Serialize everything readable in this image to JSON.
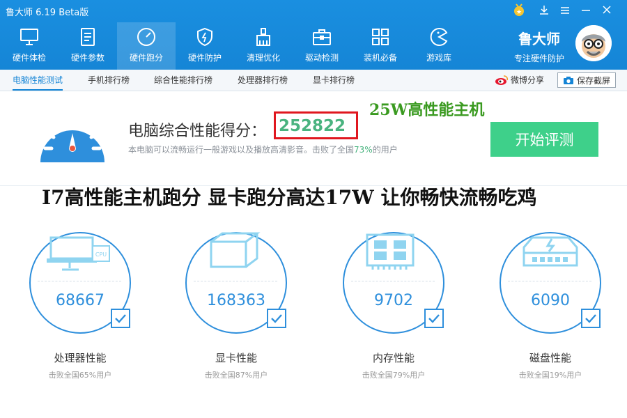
{
  "window": {
    "title": "鲁大师 6.19 Beta版"
  },
  "nav": {
    "items": [
      {
        "label": "硬件体检"
      },
      {
        "label": "硬件参数"
      },
      {
        "label": "硬件跑分"
      },
      {
        "label": "硬件防护"
      },
      {
        "label": "清理优化"
      },
      {
        "label": "驱动检测"
      },
      {
        "label": "装机必备"
      },
      {
        "label": "游戏库"
      }
    ],
    "active_index": 2
  },
  "brand": {
    "name": "鲁大师",
    "subtitle": "专注硬件防护"
  },
  "subnav": {
    "tabs": [
      {
        "label": "电脑性能测试"
      },
      {
        "label": "手机排行榜"
      },
      {
        "label": "综合性能排行榜"
      },
      {
        "label": "处理器排行榜"
      },
      {
        "label": "显卡排行榜"
      }
    ],
    "share_label": "微博分享",
    "save_label": "保存截屏"
  },
  "score": {
    "label": "电脑综合性能得分：",
    "value": "252822",
    "desc_prefix": "本电脑可以流畅运行一般游戏以及播放高清影音。击败了全国",
    "desc_pct": "73%",
    "desc_suffix": "的用户",
    "start_button": "开始评测"
  },
  "promo": {
    "line1": "25W高性能主机",
    "line2": "I7高性能主机跑分    显卡跑分高达17W  让你畅快流畅吃鸡"
  },
  "cards": [
    {
      "value": "68667",
      "title": "处理器性能",
      "sub": "击败全国65%用户"
    },
    {
      "value": "168363",
      "title": "显卡性能",
      "sub": "击败全国87%用户"
    },
    {
      "value": "9702",
      "title": "内存性能",
      "sub": "击败全国79%用户"
    },
    {
      "value": "6090",
      "title": "磁盘性能",
      "sub": "击败全国19%用户"
    }
  ],
  "colors": {
    "primary": "#1585d6",
    "score_green": "#49b37f",
    "start_button": "#3ed08a",
    "highlight_red": "#e0171f",
    "promo_green": "#3a9a20"
  }
}
